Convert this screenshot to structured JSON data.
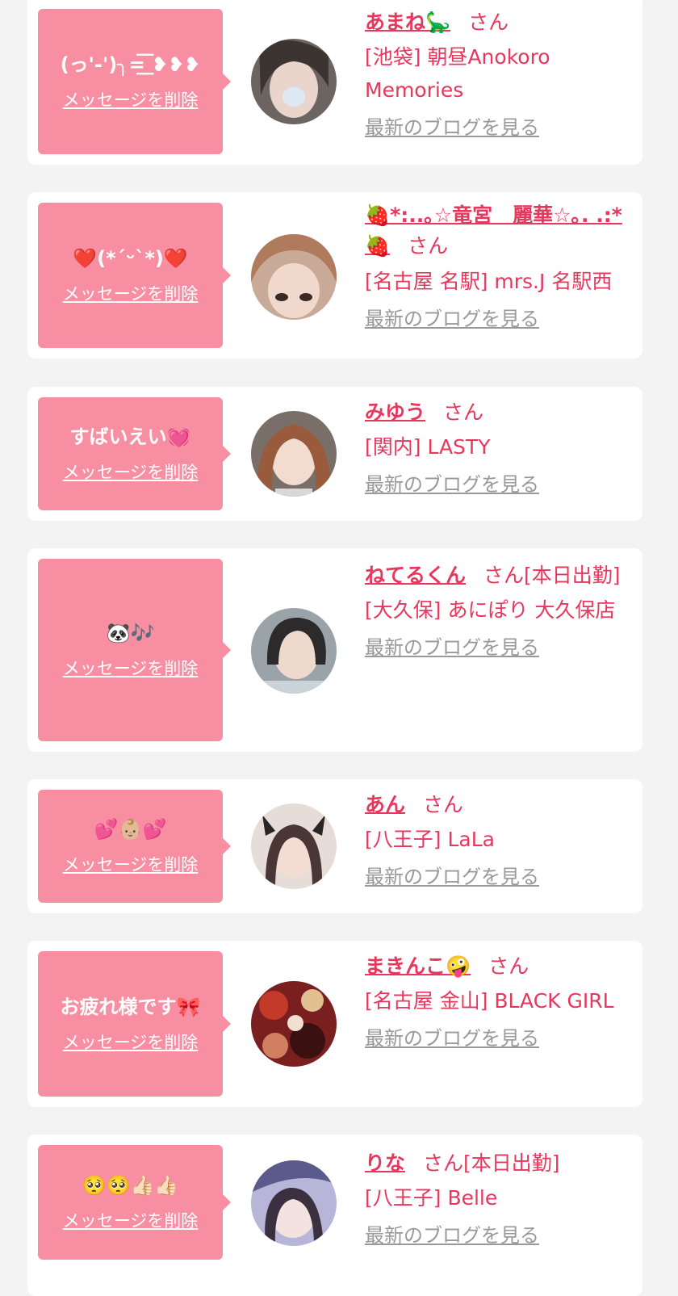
{
  "delete_label": "メッセージを削除",
  "blog_label": "最新のブログを見る",
  "san_label": "さん",
  "colors": {
    "accent": "#e8375c",
    "bubble": "#f78ea2",
    "background": "#f3f3f3",
    "link_gray": "#999999"
  },
  "entries": [
    {
      "message": "(っ'-')╮=͟͟͞͞ ❥❥❥",
      "name": "あまね🦕",
      "san_suffix": "さん",
      "shop": "[池袋] 朝昼Anokoro Memories",
      "avatar": "photo-avatar"
    },
    {
      "message": "❤️(*´ᵕ`*)❤️",
      "name": "🍓*:..｡☆竜宮　麗華☆｡. .:*🍓",
      "san_suffix": "さん",
      "shop": "[名古屋 名駅] mrs.J 名駅西",
      "avatar": "photo-avatar"
    },
    {
      "message": "すばいえい💓",
      "name": "みゆう",
      "san_suffix": "さん",
      "shop": "[関内] LASTY",
      "avatar": "photo-avatar"
    },
    {
      "message": "🐼🎶",
      "name": "ねてるくん",
      "san_suffix": "さん[本日出勤]",
      "shop": "[大久保] あにぽり 大久保店",
      "avatar": "photo-avatar"
    },
    {
      "message": "💕👶🏼💕",
      "name": "あん",
      "san_suffix": "さん",
      "shop": "[八王子] LaLa",
      "avatar": "photo-avatar"
    },
    {
      "message": "お疲れ様です🎀‪‪‪‪‪‪‪‪",
      "name": "まきんこ🤪",
      "san_suffix": "さん",
      "shop": "[名古屋 金山] BLACK GIRL",
      "avatar": "photo-avatar"
    },
    {
      "message": "🥺🥺👍🏻👍🏻",
      "name": "りな",
      "san_suffix": "さん[本日出勤]",
      "shop": "[八王子] Belle",
      "avatar": "photo-avatar"
    }
  ]
}
